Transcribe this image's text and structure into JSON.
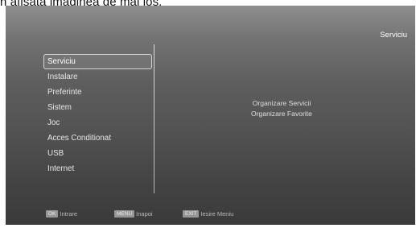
{
  "caption": "n afișată imaginea de mai jos.",
  "screen": {
    "title": "Serviciu",
    "menu": [
      {
        "label": "Serviciu",
        "selected": true
      },
      {
        "label": "Instalare",
        "selected": false
      },
      {
        "label": "Preferinte",
        "selected": false
      },
      {
        "label": "Sistem",
        "selected": false
      },
      {
        "label": "Joc",
        "selected": false
      },
      {
        "label": "Acces Conditionat",
        "selected": false
      },
      {
        "label": "USB",
        "selected": false
      },
      {
        "label": "Internet",
        "selected": false
      }
    ],
    "submenu": [
      {
        "label": "Organizare Servicii"
      },
      {
        "label": "Organizare Favorite"
      }
    ]
  },
  "footer": {
    "ok": {
      "key": "OK",
      "label": "Intrare"
    },
    "menu": {
      "key": "MENU",
      "label": "Inapoi"
    },
    "exit": {
      "key": "EXIT",
      "label": "Iesire Meniu"
    }
  }
}
